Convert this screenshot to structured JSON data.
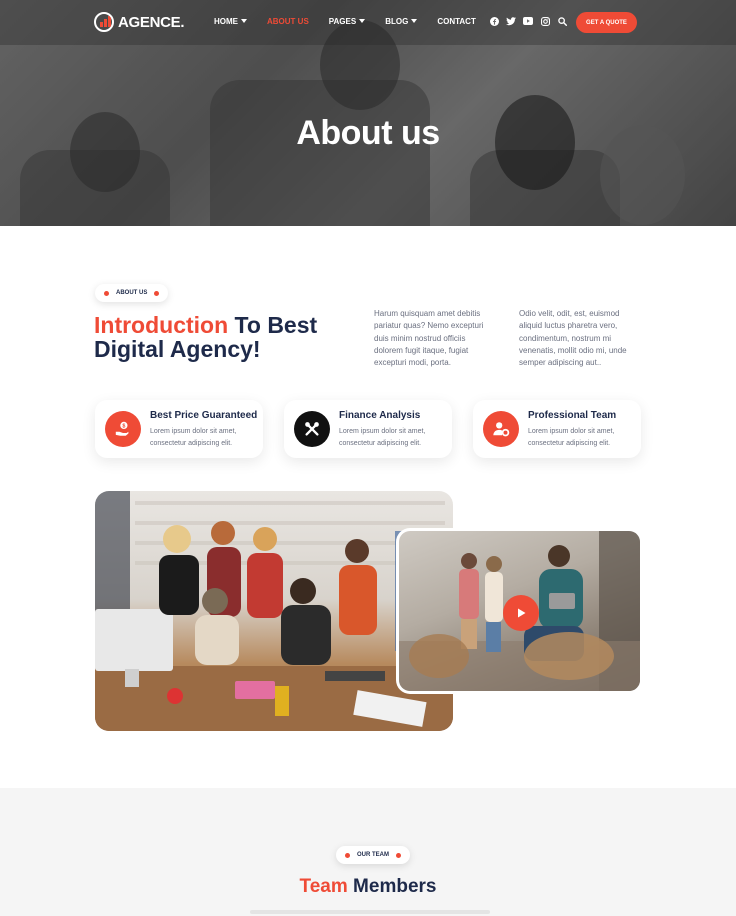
{
  "brand": {
    "name": "AGENCE."
  },
  "nav": {
    "items": [
      {
        "label": "HOME",
        "dropdown": true,
        "active": false
      },
      {
        "label": "ABOUT US",
        "dropdown": false,
        "active": true
      },
      {
        "label": "PAGES",
        "dropdown": true,
        "active": false
      },
      {
        "label": "BLOG",
        "dropdown": true,
        "active": false
      },
      {
        "label": "CONTACT",
        "dropdown": false,
        "active": false
      }
    ],
    "socials": [
      "facebook-icon",
      "twitter-icon",
      "youtube-icon",
      "instagram-icon",
      "search-icon"
    ],
    "cta": "GET A QUOTE"
  },
  "hero": {
    "title": "About us"
  },
  "about": {
    "badge": "ABOUT US",
    "heading_accent": "Introduction",
    "heading_rest": " To Best Digital Agency!",
    "para1": "Harum quisquam amet debitis pariatur quas? Nemo excepturi duis minim nostrud officiis dolorem fugit itaque, fugiat excepturi modi, porta.",
    "para2": "Odio velit, odit, est, euismod aliquid luctus pharetra vero, condimentum, nostrum mi venenatis, mollit odio mi, unde semper adipiscing aut.."
  },
  "features": [
    {
      "title": "Best Price Guaranteed",
      "desc": "Lorem ipsum dolor sit amet, consectetur adipiscing elit.",
      "icon": "money-hand-icon"
    },
    {
      "title": "Finance Analysis",
      "desc": "Lorem ipsum dolor sit amet, consectetur adipiscing elit.",
      "icon": "tools-icon"
    },
    {
      "title": "Professional Team",
      "desc": "Lorem ipsum dolor sit amet, consectetur adipiscing elit.",
      "icon": "user-gear-icon"
    }
  ],
  "team": {
    "badge": "OUR TEAM",
    "title_accent": "Team",
    "title_rest": " Members"
  },
  "colors": {
    "accent": "#ef4b36",
    "navy": "#1e2a4a",
    "muted": "#6b7080"
  }
}
